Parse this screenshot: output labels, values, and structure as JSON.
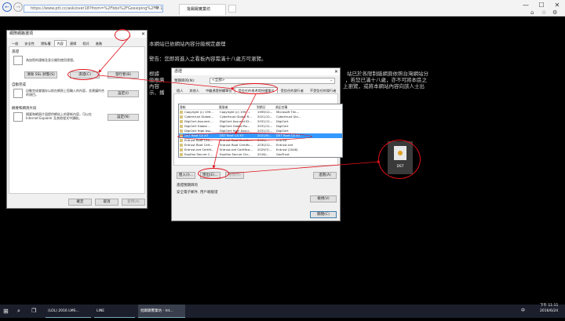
{
  "browser": {
    "address": "https://www.ptt.cc/ask/over18?from=%2Fbbs%2FGossiping%2FM.1466780082.A.C...",
    "tab_title": "批踢踢實業坊",
    "nav_back": "←",
    "nav_forward": "→",
    "window_controls": [
      "—",
      "☐",
      "✕"
    ],
    "toolbar_icons": [
      "home-icon",
      "star-icon",
      "gear-icon"
    ]
  },
  "page": {
    "line1": "本網站已依網站內容分級規定處理",
    "line2": "警告：您即將進入之看板內容需滿十八歲方可瀏覽。",
    "line3_left": "根據",
    "line3_right": "站已於各限制級網頁依照台灣網站分",
    "line4_left": "級推廣",
    "line4_right": "，若您已滿十八歲，亦不可將本區之",
    "line5_left": "內容",
    "line5_right": "上瀏覽，或將本網站內容向該人士出",
    "line6_left": "示、播"
  },
  "internet_options": {
    "title": "網際網路選項",
    "close": "✕",
    "tabs": [
      "一般",
      "安全性",
      "隱私權",
      "內容",
      "連線",
      "程式",
      "進階"
    ],
    "active_tab": 3,
    "certificates_group": "憑證",
    "certificates_desc": "為加密的連線及身分識別使用憑證。",
    "clear_ssl": "清除 SSL 狀態(S)",
    "certificates_btn": "憑證(C)",
    "publishers_btn": "發行者(B)",
    "autocomplete_group": "自動完成",
    "autocomplete_desc": "自動完成會儲存以前在網頁上您輸入的內容，並建議符合的項目。",
    "settings_btn": "設定(I)",
    "feeds_group": "摘要和網頁片段",
    "feeds_desc": "摘要和網頁片段提供網站上的更新內容，可以在 Internet Explorer 及其他程式中讀取。",
    "feeds_settings_btn": "設定(N)",
    "ok": "確定",
    "cancel": "取消",
    "apply": "套用(A)"
  },
  "cert_dialog": {
    "title": "憑證",
    "close": "✕",
    "purpose_label": "預期目的(N):",
    "purpose_value": "<全部>",
    "tabs": [
      "個人",
      "其他人",
      "中繼憑證授權單位",
      "受信任的根憑證授權單位",
      "受信任的發行者",
      "不受信任的發行者"
    ],
    "active_tab": 3,
    "columns": [
      "發給",
      "簽發者",
      "到期日",
      "易記名稱"
    ],
    "rows": [
      {
        "to": "Copyright (c) 199...",
        "by": "Copyright (c) 1997...",
        "exp": "1999/12...",
        "name": "Microsoft Tim..."
      },
      {
        "to": "Cybertrust Global...",
        "by": "Cybertrust Global R...",
        "exp": "2021/12...",
        "name": "Cybertrust Glo..."
      },
      {
        "to": "DigiCert Assured ...",
        "by": "DigiCert Assured ID...",
        "exp": "2031/11...",
        "name": "DigiCert"
      },
      {
        "to": "DigiCert Global ...",
        "by": "DigiCert Global Ro...",
        "exp": "2031/11...",
        "name": "DigiCert"
      },
      {
        "to": "DigiCert High Ass...",
        "by": "DigiCert High Assur...",
        "exp": "2031/11...",
        "name": "DigiCert"
      },
      {
        "to": "DST Root CA X3",
        "by": "DST Root CA X3",
        "exp": "2021/9/...",
        "name": "DST Root CA X3"
      },
      {
        "to": "Entrust Root Cert...",
        "by": "Entrust Root Certific...",
        "exp": "2030/...",
        "name": "Entrust"
      },
      {
        "to": "Entrust Root Cert...",
        "by": "Entrust Root Certific...",
        "exp": "2030/12...",
        "name": "Entrust.net"
      },
      {
        "to": "Entrust.net Certifi...",
        "by": "Entrust.net Certifica...",
        "exp": "2029/7/...",
        "name": "Entrust (2048)"
      },
      {
        "to": "Equifax Secure C...",
        "by": "Equifax Secure Cer...",
        "exp": "2018/...",
        "name": "GeoTrust"
      }
    ],
    "selected_row": 5,
    "import_btn": "匯入(I)...",
    "export_btn": "匯出(E)...",
    "remove_btn": "移除(R)",
    "advanced_btn": "進階(A)",
    "purposes_label": "憑證預期目的",
    "purposes_value": "安全電子郵件, 用戶端驗證",
    "view_btn": "檢視(V)",
    "close_btn": "關閉(C)"
  },
  "desktop_file": {
    "label": "DST"
  },
  "taskbar": {
    "items": [
      "(LOL) 2016 LMS...",
      "LINE",
      "批踢踢實業坊 - Int..."
    ],
    "ime": "中",
    "time": "下午 11:11",
    "date": "2016/6/24"
  }
}
